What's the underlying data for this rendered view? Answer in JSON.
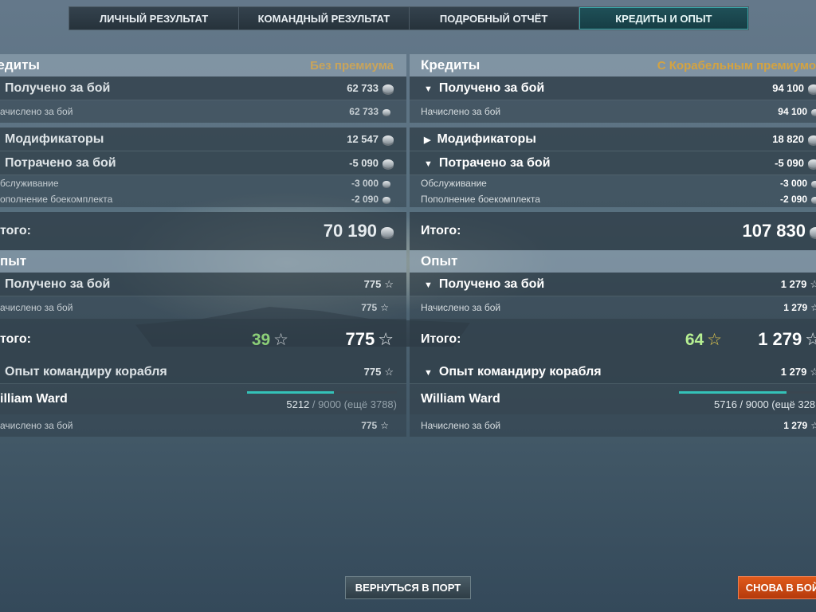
{
  "tabs": [
    {
      "label": "ЛИЧНЫЙ РЕЗУЛЬТАТ",
      "active": false
    },
    {
      "label": "КОМАНДНЫЙ РЕЗУЛЬТАТ",
      "active": false
    },
    {
      "label": "ПОДРОБНЫЙ ОТЧЁТ",
      "active": false
    },
    {
      "label": "КРЕДИТЫ И ОПЫТ",
      "active": true
    }
  ],
  "left": {
    "credits_title": "редиты",
    "premium_label": "Без премиума",
    "earned_label": "Получено за бой",
    "earned_value": "62 733",
    "accrued_label": "ачислено за бой",
    "accrued_value": "62 733",
    "modifiers_label": "Модификаторы",
    "modifiers_value": "12 547",
    "spent_label": "Потрачено за бой",
    "spent_value": "-5 090",
    "service_label": "бслуживание",
    "service_value": "-3 000",
    "ammo_label": "ополнение боекомплекта",
    "ammo_value": "-2 090",
    "total_label": "того:",
    "total_value": "70 190",
    "xp_title": "пыт",
    "xp_earned_label": "Получено за бой",
    "xp_earned_value": "775",
    "xp_accrued_label": "ачислено за бой",
    "xp_accrued_value": "775",
    "xp_total_label": "того:",
    "xp_total_free": "39",
    "xp_total_value": "775",
    "cmd_label": "Опыт командиру корабля",
    "cmd_value": "775",
    "commander_name": "illiam Ward",
    "commander_progress": "5212",
    "commander_progress_rest": " / 9000 (ещё 3788)",
    "commander_progress_fraction": 0.579,
    "cmd_accrued_label": "ачислено за бой",
    "cmd_accrued_value": "775"
  },
  "right": {
    "credits_title": "Кредиты",
    "premium_label": "С Корабельным премиумо",
    "earned_label": "Получено за бой",
    "earned_value": "94 100",
    "accrued_label": "Начислено за бой",
    "accrued_value": "94 100",
    "modifiers_label": "Модификаторы",
    "modifiers_value": "18 820",
    "spent_label": "Потрачено за бой",
    "spent_value": "-5 090",
    "service_label": "Обслуживание",
    "service_value": "-3 000",
    "ammo_label": "Пополнение боекомплекта",
    "ammo_value": "-2 090",
    "total_label": "Итого:",
    "total_value": "107 830",
    "xp_title": "Опыт",
    "xp_earned_label": "Получено за бой",
    "xp_earned_value": "1 279",
    "xp_accrued_label": "Начислено за бой",
    "xp_accrued_value": "1 279",
    "xp_total_label": "Итого:",
    "xp_total_free": "64",
    "xp_total_value": "1 279",
    "cmd_label": "Опыт командиру корабля",
    "cmd_value": "1 279",
    "commander_name": "William Ward",
    "commander_progress": "5716 / 9000 (ещё 328",
    "commander_progress_fraction": 0.635,
    "cmd_accrued_label": "Начислено за бой",
    "cmd_accrued_value": "1 279"
  },
  "buttons": {
    "port": "ВЕРНУТЬСЯ В ПОРТ",
    "battle": "СНОВА В БОЙ"
  },
  "icons": {
    "credit": "credit-coin-icon",
    "xp": "star-icon",
    "expand": "triangle-right-icon",
    "collapse": "triangle-down-icon"
  },
  "colors": {
    "premium_gold": "#d4a340",
    "free_xp_green": "#a9e089",
    "active_tab": "#1f5058",
    "battle_button": "#d04a14"
  }
}
